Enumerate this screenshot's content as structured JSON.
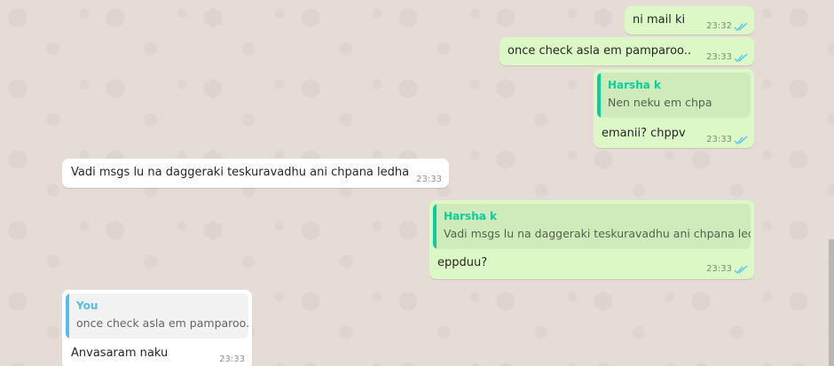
{
  "theme": {
    "outgoing_bubble": "#dcf8c6",
    "incoming_bubble": "#ffffff",
    "read_tick": "#4fc3f7",
    "quote_green": "#06cf9c",
    "quote_blue": "#53bdeb",
    "background": "#e5ddd5"
  },
  "messages": [
    {
      "direction": "out",
      "text": "ni mail ki",
      "time": "23:32",
      "status_icon": "double-check-read-icon"
    },
    {
      "direction": "out",
      "text": "once check asla em pamparoo..",
      "time": "23:33",
      "status_icon": "double-check-read-icon"
    },
    {
      "direction": "out",
      "quote": {
        "author": "Harsha k",
        "text": "Nen neku em chpa"
      },
      "text": "emanii? chppv",
      "time": "23:33",
      "status_icon": "double-check-read-icon"
    },
    {
      "direction": "in",
      "text": "Vadi msgs lu na daggeraki teskuravadhu ani chpana ledha",
      "time": "23:33"
    },
    {
      "direction": "out",
      "quote": {
        "author": "Harsha k",
        "text": "Vadi msgs lu na daggeraki teskuravadhu ani chpana ledha"
      },
      "text": "eppduu?",
      "time": "23:33",
      "status_icon": "double-check-read-icon"
    },
    {
      "direction": "in",
      "quote": {
        "author": "You",
        "text": "once check asla em pamparoo.."
      },
      "text": "Anvasaram naku",
      "time": "23:33"
    }
  ]
}
